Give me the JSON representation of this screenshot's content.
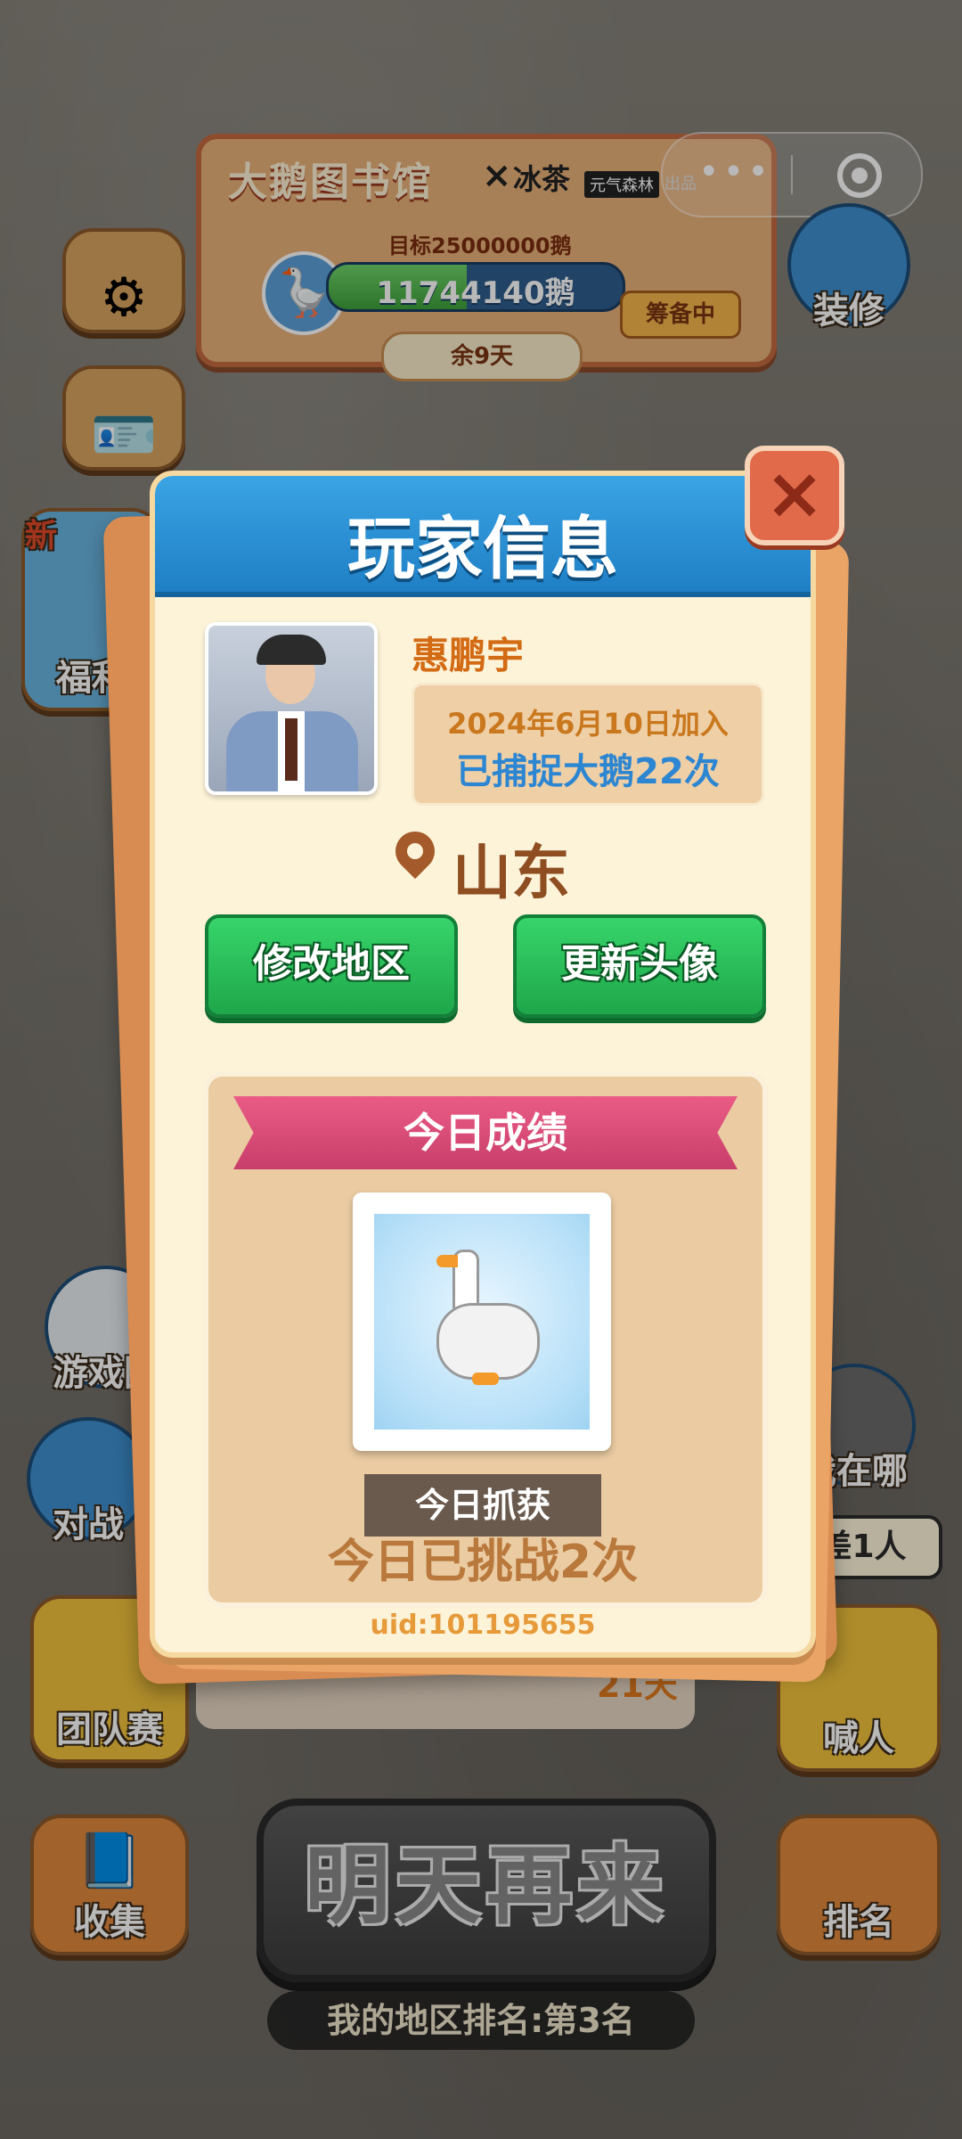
{
  "banner": {
    "title": "大鹅图书馆",
    "x": "×",
    "brand": "冰茶",
    "brand2": "元气森林",
    "brand3": "出品",
    "goal": "目标25000000鹅",
    "progress_value": "11744140鹅",
    "progress_fraction": 0.47,
    "status": "筹备中",
    "days_left": "余9天"
  },
  "capsule": {
    "more": "•••"
  },
  "side": {
    "renovate": "装修",
    "welfare": "福利",
    "new": "新",
    "game_circle": "游戏圈",
    "battle": "对战",
    "team": "团队赛",
    "collect": "收集",
    "where": "我在哪",
    "shout": "喊人",
    "rank": "排名",
    "short_one": "差1人"
  },
  "bottom": {
    "main_button": "明天再来",
    "rank_text": "我的地区排名:第3名",
    "behind_days": "21天"
  },
  "modal": {
    "title": "玩家信息",
    "close": "×",
    "username": "惠鹏宇",
    "join_date": "2024年6月10日加入",
    "capture_count": "已捕捉大鹅22次",
    "location": "山东",
    "change_region": "修改地区",
    "update_avatar": "更新头像",
    "today_title": "今日成绩",
    "today_catch": "今日抓获",
    "challenge_text": "今日已挑战2次",
    "uid": "uid:101195655"
  }
}
